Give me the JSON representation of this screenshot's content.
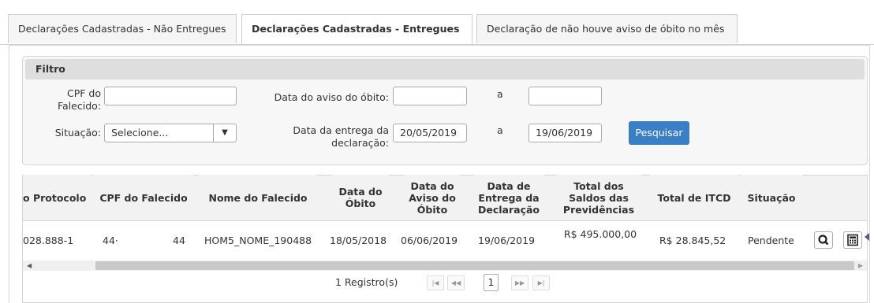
{
  "tabs": [
    {
      "label": "Declarações Cadastradas - Não Entregues"
    },
    {
      "label": "Declarações Cadastradas - Entregues"
    },
    {
      "label": "Declaração de não houve aviso de óbito no mês"
    }
  ],
  "filtro": {
    "title": "Filtro",
    "cpf_label": "CPF do Falecido:",
    "cpf_value": "",
    "data_aviso_label": "Data do aviso do óbito:",
    "data_aviso_from": "",
    "a_label": "a",
    "data_aviso_to": "",
    "situacao_label": "Situação:",
    "situacao_value": "Selecione...",
    "data_entrega_label": "Data da entrega da declaração:",
    "data_entrega_from": "20/05/2019",
    "data_entrega_to": "19/06/2019",
    "search_button": "Pesquisar"
  },
  "table": {
    "headers": [
      "o Protocolo",
      "CPF do Falecido",
      "Nome do Falecido",
      "Data do Óbito",
      "Data do Aviso do Óbito",
      "Data de Entrega da Declaração",
      "Total dos Saldos das Previdências",
      "Total de ITCD",
      "Situação"
    ],
    "row": {
      "protocolo": "028.888-1",
      "cpf_a": "44·",
      "cpf_b": "44",
      "nome": "HOM5_NOME_190488",
      "data_obito": "18/05/2018",
      "data_aviso": "06/06/2019",
      "data_entrega": "19/06/2019",
      "total_saldos": "R$ 495.000,00",
      "total_itcd": "R$ 28.845,52",
      "situacao": "Pendente"
    }
  },
  "pager": {
    "records": "1 Registro(s)",
    "current_page": "1"
  }
}
